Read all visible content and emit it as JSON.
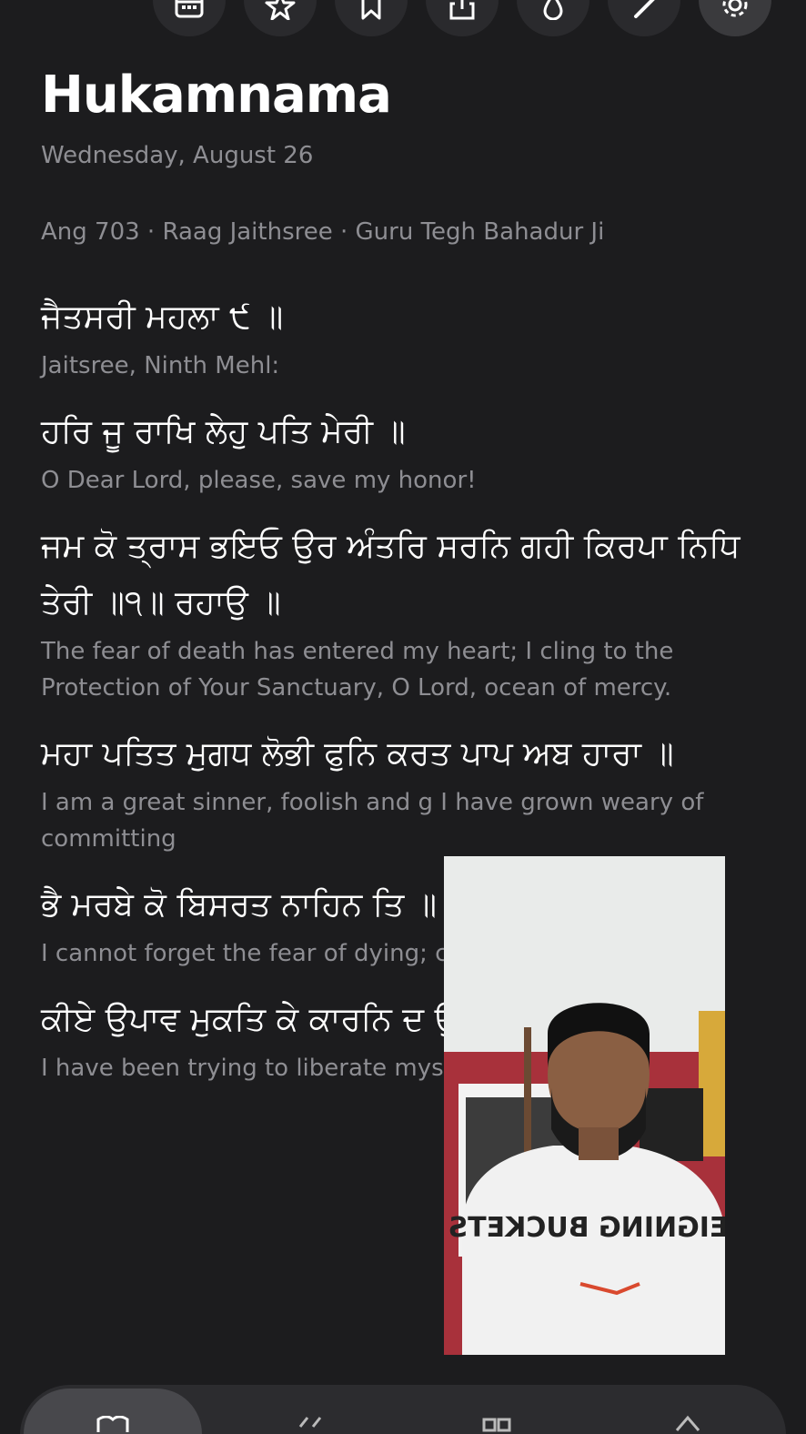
{
  "toolbar": {
    "buttons": [
      {
        "icon": "calendar-icon"
      },
      {
        "icon": "star-icon"
      },
      {
        "icon": "bookmark-icon"
      },
      {
        "icon": "share-icon"
      },
      {
        "icon": "drop-icon"
      },
      {
        "icon": "pencil-icon"
      },
      {
        "icon": "gear-icon"
      }
    ]
  },
  "header": {
    "title": "Hukamnama",
    "date": "Wednesday, August 26",
    "meta": "Ang 703 · Raag Jaithsree · Guru Tegh Bahadur Ji"
  },
  "verses": [
    {
      "gurmukhi": "ਜੈਤਸਰੀ ਮਹਲਾ ੯ ॥",
      "translation": "Jaitsree, Ninth Mehl:"
    },
    {
      "gurmukhi": "ਹਰਿ ਜੂ ਰਾਖਿ ਲੇਹੁ ਪਤਿ ਮੇਰੀ ॥",
      "translation": "O Dear Lord, please, save my honor!"
    },
    {
      "gurmukhi": "ਜਮ ਕੋ ਤ੍ਰਾਸ ਭਇਓ ਉਰ ਅੰਤਰਿ ਸਰਨਿ ਗਹੀ ਕਿਰਪਾ ਨਿਧਿ ਤੇਰੀ ॥੧॥ ਰਹਾਉ ॥",
      "translation": "The fear of death has entered my heart; I cling to the Protection of Your Sanctuary, O Lord, ocean of mercy."
    },
    {
      "gurmukhi": "ਮਹਾ ਪਤਿਤ ਮੁਗਧ ਲੋਭੀ ਫੁਨਿ ਕਰਤ ਪਾਪ ਅਬ ਹਾਰਾ ॥",
      "translation": "I am a great sinner, foolish and g I have grown weary of committing"
    },
    {
      "gurmukhi": "ਭੈ ਮਰਬੇ ਕੋ ਬਿਸਰਤ ਨਾਹਿਨ ਤਿ ॥",
      "translation": "I cannot forget the fear of dying; consuming my body."
    },
    {
      "gurmukhi": "ਕੀਏ ਉਪਾਵ ਮੁਕਤਿ ਕੇ ਕਾਰਨਿ ਦ ਉਠਿ ਧਾਇਆ ॥",
      "translation": "I have been trying to liberate mys the ten directions."
    }
  ],
  "pip_video": {
    "shirt_text": "REIGNING BUCKETS"
  },
  "tabbar": {
    "tabs": [
      {
        "icon": "book-icon",
        "active": true
      },
      {
        "icon": "chevrons-icon",
        "active": false
      },
      {
        "icon": "grid-icon",
        "active": false
      },
      {
        "icon": "home-icon",
        "active": false
      }
    ]
  },
  "colors": {
    "background": "#1c1c1e",
    "primary_text": "#ffffff",
    "secondary_text": "#8e8e93",
    "button_bg": "#2a2a2d"
  }
}
